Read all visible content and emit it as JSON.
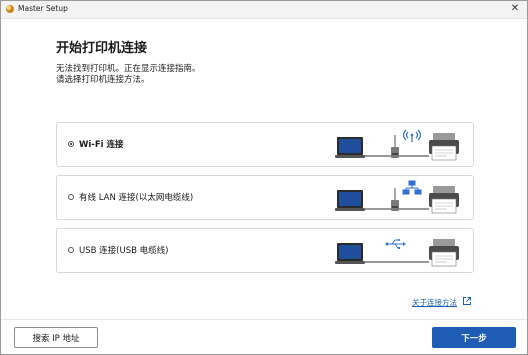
{
  "window": {
    "title": "Master Setup",
    "close_glyph": "✕"
  },
  "page": {
    "heading": "开始打印机连接",
    "desc_line1": "无法找到打印机。正在显示连接指南。",
    "desc_line2": "请选择打印机连接方法。"
  },
  "options": [
    {
      "label": "Wi-Fi 连接",
      "selected": true,
      "icon": "wifi-icon"
    },
    {
      "label": "有线 LAN 连接(以太网电缆线)",
      "selected": false,
      "icon": "network-icon"
    },
    {
      "label": "USB 连接(USB 电缆线)",
      "selected": false,
      "icon": "usb-icon"
    }
  ],
  "help": {
    "link_label": "关于连接方法",
    "icon": "external-link-icon"
  },
  "footer": {
    "search_ip_label": "搜索 IP 地址",
    "next_label": "下一步"
  },
  "colors": {
    "accent": "#1e5cb6",
    "link": "#1a5fb4",
    "signal": "#2f6fd6",
    "laptop_screen": "#1f4f9c"
  }
}
